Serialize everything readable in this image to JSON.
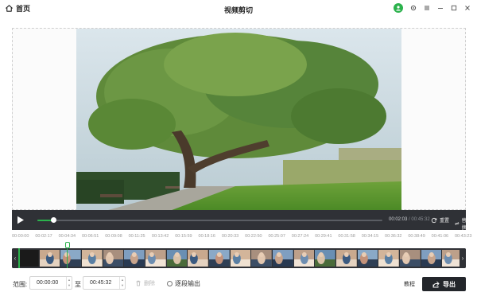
{
  "titlebar": {
    "home_label": "首页",
    "title": "视频剪切"
  },
  "player": {
    "current_time": "00:02:03",
    "separator": "/",
    "total_time": "00:45:32",
    "progress_fraction": 0.045,
    "reset_label": "重置",
    "replace_label": "替换"
  },
  "ruler": {
    "ticks": [
      "00:00:00",
      "00:02:17",
      "00:04:34",
      "00:06:51",
      "00:09:08",
      "00:11:25",
      "00:13:42",
      "00:15:59",
      "00:18:16",
      "00:20:33",
      "00:22:50",
      "00:25:07",
      "00:27:24",
      "00:29:41",
      "00:31:58",
      "00:34:15",
      "00:36:32",
      "00:38:49",
      "00:41:06",
      "00:43:23"
    ]
  },
  "timeline": {
    "left_arrow": "‹",
    "right_arrow": "›",
    "thumbnail_count": 21
  },
  "bottom": {
    "range_label": "范围:",
    "start_time": "00:00:00",
    "to_label": "至",
    "end_time": "00:45:32",
    "delete_label": "删除",
    "segment_output_label": "逐段输出",
    "tutorial_label": "教程",
    "export_label": "导出"
  },
  "colors": {
    "accent": "#2bb24c",
    "dark_bar": "#2f3136",
    "export_bg": "#23262b"
  },
  "icons": {
    "home": "home-icon",
    "user": "user-avatar-icon",
    "settings": "settings-icon",
    "menu": "menu-icon",
    "minimize": "minimize-icon",
    "maximize": "maximize-icon",
    "close": "close-icon",
    "play": "play-icon",
    "reset": "refresh-icon",
    "replace": "swap-icon",
    "delete": "trash-icon",
    "export": "share-icon"
  }
}
